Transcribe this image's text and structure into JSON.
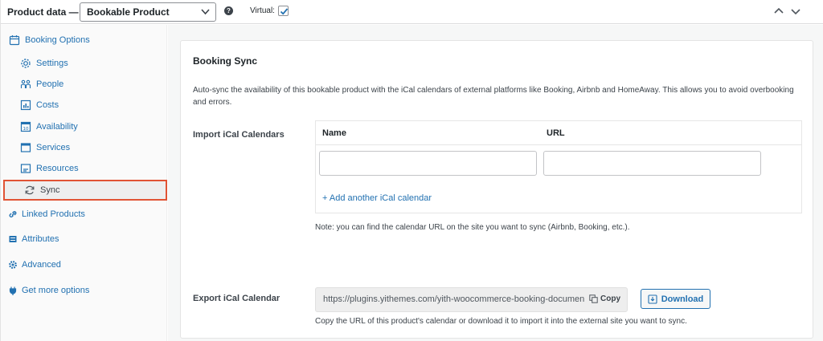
{
  "header": {
    "title": "Product data —",
    "product_type": "Bookable Product",
    "help_icon": "question-icon",
    "virtual_label": "Virtual:",
    "virtual_checked": true
  },
  "sidebar": {
    "items": [
      {
        "label": "Booking Options",
        "icon": "calendar-icon"
      },
      {
        "label": "Settings",
        "icon": "gear-icon"
      },
      {
        "label": "People",
        "icon": "people-icon"
      },
      {
        "label": "Costs",
        "icon": "costs-icon"
      },
      {
        "label": "Availability",
        "icon": "availability-calendar-icon"
      },
      {
        "label": "Services",
        "icon": "services-icon"
      },
      {
        "label": "Resources",
        "icon": "resources-icon"
      },
      {
        "label": "Sync",
        "icon": "sync-icon"
      },
      {
        "label": "Linked Products",
        "icon": "link-icon"
      },
      {
        "label": "Attributes",
        "icon": "list-icon"
      },
      {
        "label": "Advanced",
        "icon": "gear-icon"
      },
      {
        "label": "Get more options",
        "icon": "plugin-icon"
      }
    ],
    "active": "Sync"
  },
  "main": {
    "title": "Booking Sync",
    "description": "Auto-sync the availability of this bookable product with the iCal calendars of external platforms like Booking, Airbnb and HomeAway. This allows you to avoid overbooking and errors.",
    "import": {
      "label": "Import iCal Calendars",
      "col_name": "Name",
      "col_url": "URL",
      "name_value": "",
      "url_value": "",
      "add_link": "+ Add another iCal calendar",
      "note": "Note: you can find the calendar URL on the site you want to sync (Airbnb, Booking, etc.)."
    },
    "export": {
      "label": "Export iCal Calendar",
      "url": "https://plugins.yithemes.com/yith-woocommerce-booking-documentation",
      "copy_label": "Copy",
      "download_label": "Download",
      "help": "Copy the URL of this product's calendar or download it to import it into the external site you want to sync."
    }
  },
  "colors": {
    "link": "#2271b1",
    "active_outline": "#e15334",
    "text": "#3c434a"
  }
}
